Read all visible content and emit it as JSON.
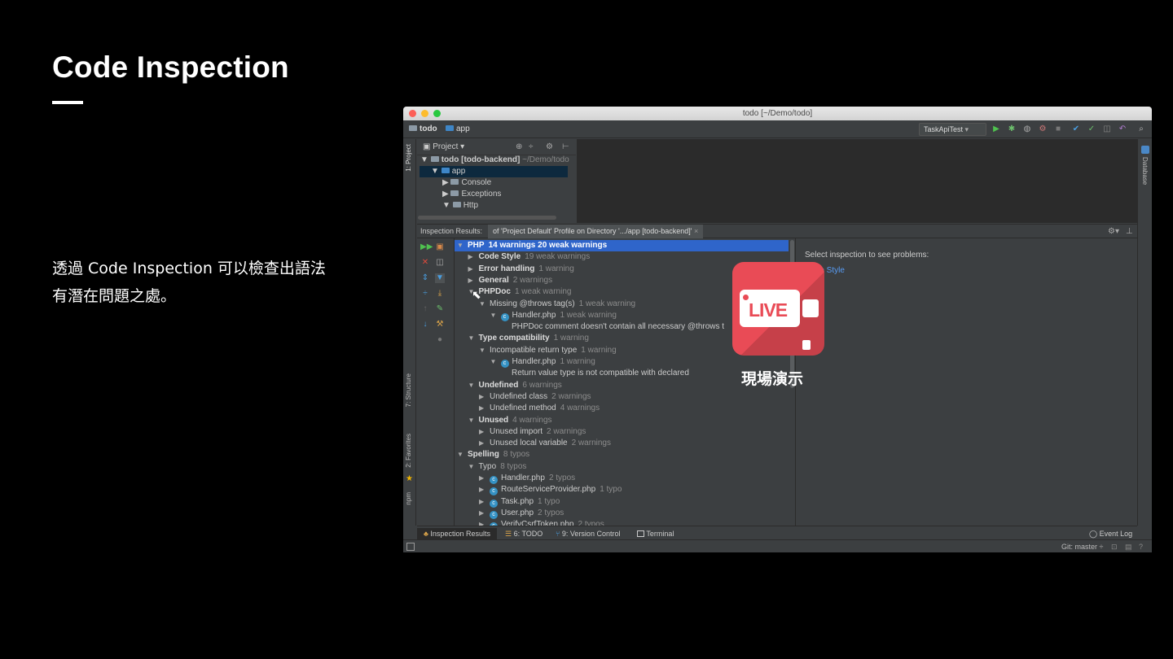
{
  "slide": {
    "title": "Code Inspection",
    "body_line1": "透過 Code Inspection 可以檢查出語法",
    "body_line2": "有潛在問題之處。"
  },
  "ide": {
    "window_title": "todo [~/Demo/todo]",
    "breadcrumb": [
      "todo",
      "app"
    ],
    "run_config": "TaskApiTest",
    "left_tools": [
      "1: Project",
      "7: Structure",
      "2: Favorites",
      "npm"
    ],
    "right_tools": [
      "Database"
    ],
    "project_panel": {
      "view_name": "Project",
      "rows": [
        {
          "name": "todo [todo-backend]",
          "path": "~/Demo/todo"
        },
        {
          "name": "app"
        },
        {
          "name": "Console"
        },
        {
          "name": "Exceptions"
        },
        {
          "name": "Http"
        }
      ]
    },
    "inspection": {
      "label": "Inspection Results:",
      "tab_title": "of 'Project Default' Profile on Directory '.../app [todo-backend]'",
      "detail_message": "Select inspection to see problems:",
      "detail_link": "Code Style",
      "rows": [
        {
          "arrow": "▼",
          "name": "PHP",
          "count": "14 warnings 20 weak warnings",
          "bold": true
        },
        {
          "arrow": "▶",
          "name": "Code Style",
          "count": "19 weak warnings",
          "bold": true
        },
        {
          "arrow": "▶",
          "name": "Error handling",
          "count": "1 warning",
          "bold": true
        },
        {
          "arrow": "▶",
          "name": "General",
          "count": "2 warnings",
          "bold": true
        },
        {
          "arrow": "▼",
          "name": "PHPDoc",
          "count": "1 weak warning",
          "bold": true
        },
        {
          "arrow": "▼",
          "name": "Missing @throws tag(s)",
          "count": "1 weak warning",
          "bold": false
        },
        {
          "arrow": "▼",
          "name": "Handler.php",
          "count": "1 weak warning",
          "bold": false,
          "file": true
        },
        {
          "arrow": "",
          "name": "PHPDoc comment doesn't contain all necessary @throws t",
          "count": "",
          "bold": false,
          "message": true
        },
        {
          "arrow": "▼",
          "name": "Type compatibility",
          "count": "1 warning",
          "bold": true
        },
        {
          "arrow": "▼",
          "name": "Incompatible return type",
          "count": "1 warning",
          "bold": false
        },
        {
          "arrow": "▼",
          "name": "Handler.php",
          "count": "1 warning",
          "bold": false,
          "file": true
        },
        {
          "arrow": "",
          "name": "Return value type is not compatible with declared",
          "count": "",
          "bold": false,
          "message": true
        },
        {
          "arrow": "▼",
          "name": "Undefined",
          "count": "6 warnings",
          "bold": true
        },
        {
          "arrow": "▶",
          "name": "Undefined class",
          "count": "2 warnings",
          "bold": false
        },
        {
          "arrow": "▶",
          "name": "Undefined method",
          "count": "4 warnings",
          "bold": false
        },
        {
          "arrow": "▼",
          "name": "Unused",
          "count": "4 warnings",
          "bold": true
        },
        {
          "arrow": "▶",
          "name": "Unused import",
          "count": "2 warnings",
          "bold": false
        },
        {
          "arrow": "▶",
          "name": "Unused local variable",
          "count": "2 warnings",
          "bold": false
        },
        {
          "arrow": "▼",
          "name": "Spelling",
          "count": "8 typos",
          "bold": true
        },
        {
          "arrow": "▼",
          "name": "Typo",
          "count": "8 typos",
          "bold": false
        },
        {
          "arrow": "▶",
          "name": "Handler.php",
          "count": "2 typos",
          "bold": false,
          "file": true
        },
        {
          "arrow": "▶",
          "name": "RouteServiceProvider.php",
          "count": "1 typo",
          "bold": false,
          "file": true
        },
        {
          "arrow": "▶",
          "name": "Task.php",
          "count": "1 typo",
          "bold": false,
          "file": true
        },
        {
          "arrow": "▶",
          "name": "User.php",
          "count": "2 typos",
          "bold": false,
          "file": true
        },
        {
          "arrow": "▶",
          "name": "VerifyCsrfToken.php",
          "count": "2 typos",
          "bold": false,
          "file": true
        }
      ]
    },
    "bottom_tabs": [
      "Inspection Results",
      "6: TODO",
      "9: Version Control",
      "Terminal"
    ],
    "event_log": "Event Log",
    "git_status": "Git: master ÷"
  },
  "overlay": {
    "live_text": "LIVE",
    "caption": "現場演示"
  },
  "colors": {
    "live_red": "#e94b56",
    "selection_blue": "#2f65ca",
    "link_blue": "#589df6"
  }
}
